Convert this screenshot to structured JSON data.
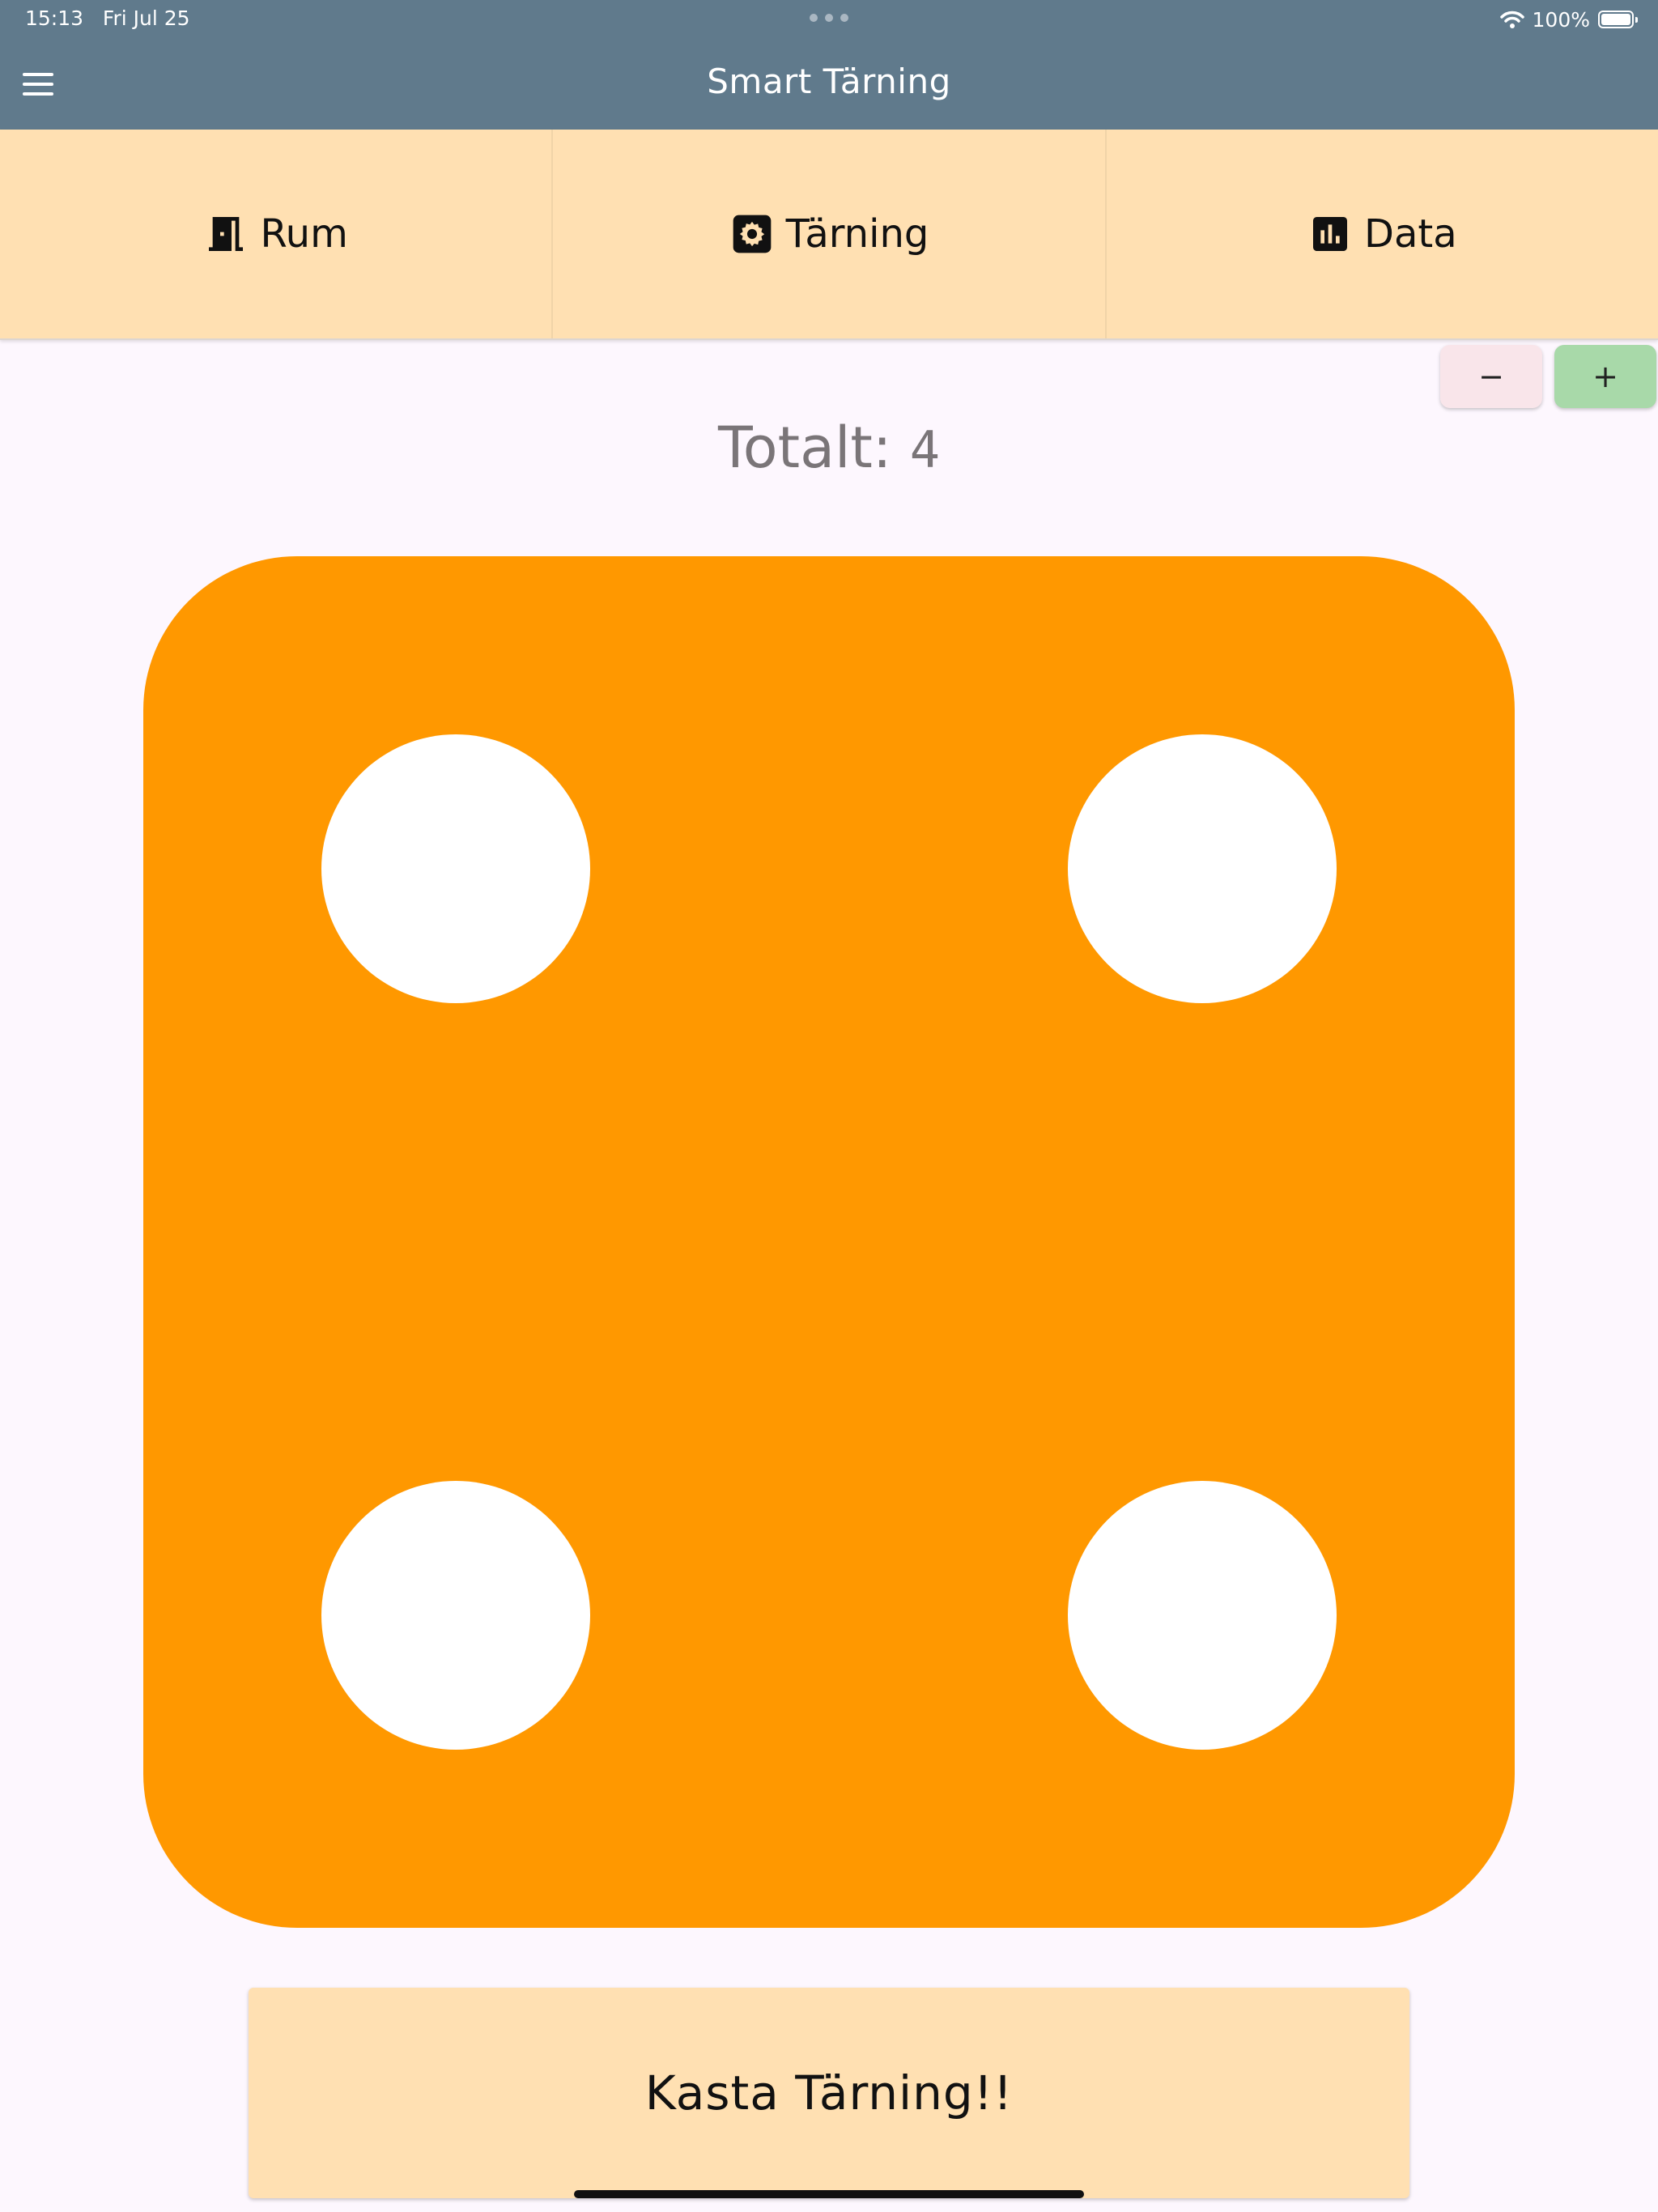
{
  "status_bar": {
    "time": "15:13",
    "date": "Fri Jul 25",
    "battery": "100%"
  },
  "app_bar": {
    "title": "Smart Tärning"
  },
  "tabs": [
    {
      "label": "Rum",
      "icon": "door-icon"
    },
    {
      "label": "Tärning",
      "icon": "settings-icon"
    },
    {
      "label": "Data",
      "icon": "bar-chart-icon"
    }
  ],
  "stepper": {
    "minus_label": "−",
    "plus_label": "+"
  },
  "total": {
    "label": "Totalt:",
    "value": "4"
  },
  "die": {
    "face_value": 4,
    "color": "#FF9800",
    "pip_color": "#FFFFFF"
  },
  "roll_button": {
    "label": "Kasta Tärning!!"
  },
  "colors": {
    "app_bar": "#607A8C",
    "tab_bar": "#FFE0B2",
    "background": "#FDF7FE",
    "minus_button": "#F9E5EA",
    "plus_button": "#A8D9A9"
  }
}
